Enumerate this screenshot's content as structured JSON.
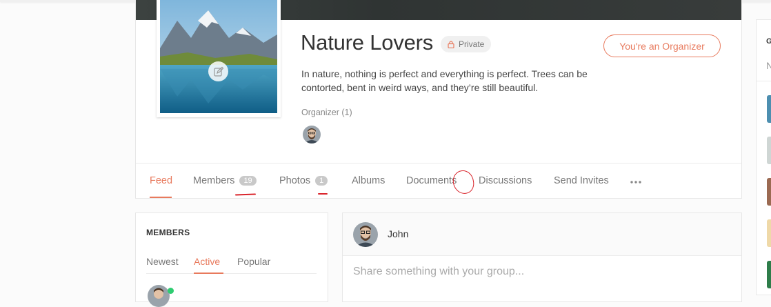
{
  "group": {
    "title": "Nature Lovers",
    "privacy_label": "Private",
    "organizer_button": "You're an Organizer",
    "description": "In nature, nothing is perfect and everything is perfect. Trees can be contorted, bent in weird ways, and they’re still beautiful.",
    "organizer_label": "Organizer (1)"
  },
  "tabs": [
    {
      "label": "Feed",
      "count": null,
      "active": true
    },
    {
      "label": "Members",
      "count": "19",
      "active": false
    },
    {
      "label": "Photos",
      "count": "1",
      "active": false
    },
    {
      "label": "Albums",
      "count": null,
      "active": false
    },
    {
      "label": "Documents",
      "count": null,
      "active": false
    },
    {
      "label": "Discussions",
      "count": null,
      "active": false
    },
    {
      "label": "Send Invites",
      "count": null,
      "active": false
    }
  ],
  "members_widget": {
    "title": "MEMBERS",
    "tabs": [
      "Newest",
      "Active",
      "Popular"
    ],
    "active_tab": "Active"
  },
  "composer": {
    "user_name": "John",
    "placeholder": "Share something with your group..."
  },
  "sidebar": {
    "heading_initial": "G",
    "subheading_initial": "N"
  },
  "colors": {
    "accent": "#e87a5d",
    "annotation": "#d9232a",
    "online": "#2ecc71"
  },
  "icons": {
    "privacy": "lock-icon",
    "edit": "pencil-icon",
    "more": "ellipsis-icon"
  }
}
